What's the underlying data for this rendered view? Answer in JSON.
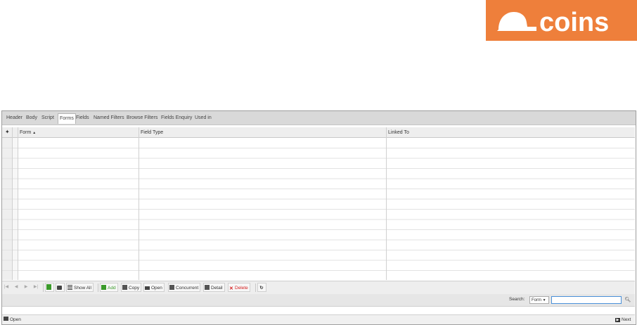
{
  "brand": {
    "logo_text": "coins",
    "color": "#ee7f3b"
  },
  "tabs": [
    {
      "label": "Header",
      "active": false
    },
    {
      "label": "Body",
      "active": false
    },
    {
      "label": "Script",
      "active": false
    },
    {
      "label": "Forms",
      "active": true
    },
    {
      "label": "Fields",
      "active": false
    },
    {
      "label": "Named Filters",
      "active": false
    },
    {
      "label": "Browse Filters",
      "active": false
    },
    {
      "label": "Fields Enquiry",
      "active": false
    },
    {
      "label": "Used in",
      "active": false
    }
  ],
  "grid": {
    "pin_icon": "pin-icon",
    "columns": [
      {
        "label": "Form",
        "sort": "asc"
      },
      {
        "label": "Field Type"
      },
      {
        "label": "Linked To"
      }
    ],
    "sort_indicator": "▲",
    "rows": []
  },
  "toolbar": {
    "nav": [
      "first-page-icon",
      "prev-page-icon",
      "next-page-icon",
      "last-page-icon"
    ],
    "show_all": "Show All",
    "add": "Add",
    "copy": "Copy",
    "open": "Open",
    "concurrent": "Concurrent",
    "detail": "Detail",
    "delete": "Delete",
    "colors": {
      "add": "#3a9a2a",
      "delete": "#d42020"
    }
  },
  "search": {
    "label": "Search:",
    "selected_field": "Form",
    "query": ""
  },
  "bottom": {
    "open": "Open",
    "next": "Next"
  }
}
